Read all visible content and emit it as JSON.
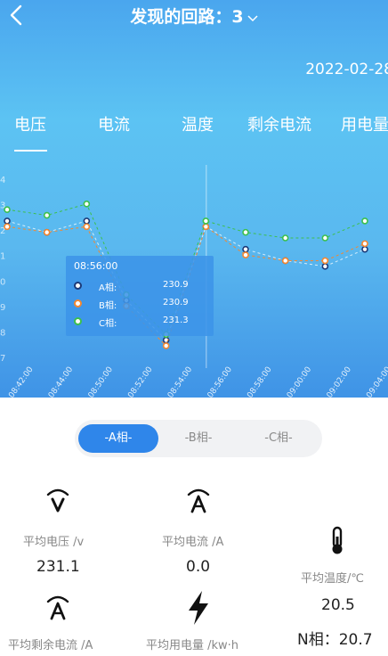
{
  "header": {
    "title": "发现的回路：3",
    "date": "2022-02-28"
  },
  "tabs": [
    {
      "label": "电压"
    },
    {
      "label": "电流"
    },
    {
      "label": "温度"
    },
    {
      "label": "剩余电流"
    },
    {
      "label": "用电量"
    }
  ],
  "chart_data": {
    "type": "line",
    "x": [
      "08:42:00",
      "08:44:00",
      "08:50:00",
      "08:52:00",
      "08:54:00",
      "08:56:00",
      "08:58:00",
      "09:00:00",
      "09:02:00",
      "09:04:00"
    ],
    "series": [
      {
        "name": "A相",
        "color": "#ffffff",
        "values": [
          231.0,
          230.8,
          231.0,
          229.6,
          228.9,
          230.9,
          230.5,
          230.3,
          230.2,
          230.5
        ]
      },
      {
        "name": "B相",
        "color": "#f5872f",
        "values": [
          230.9,
          230.8,
          230.9,
          229.5,
          228.8,
          230.9,
          230.4,
          230.3,
          230.3,
          230.6
        ]
      },
      {
        "name": "C相",
        "color": "#3cc04d",
        "values": [
          231.2,
          231.1,
          231.3,
          229.7,
          229.0,
          231.0,
          230.8,
          230.7,
          230.7,
          231.0
        ]
      }
    ],
    "ylim": [
      228.5,
      231.8
    ],
    "yticks": [
      "4",
      "3",
      "2",
      "1",
      "0",
      "9",
      "8",
      "7"
    ]
  },
  "tooltip": {
    "time": "08:56:00",
    "rows": [
      {
        "name": "A相:",
        "value": "230.9",
        "color": "#ffffff"
      },
      {
        "name": "B相:",
        "value": "230.9",
        "color": "#f5872f"
      },
      {
        "name": "C相:",
        "value": "231.3",
        "color": "#3cc04d"
      }
    ]
  },
  "phase_selector": {
    "items": [
      "-A相-",
      "-B相-",
      "-C相-"
    ],
    "active_index": 0
  },
  "stats": {
    "avg_voltage": {
      "label": "平均电压 /v",
      "value": "231.1",
      "icon": "voltage-v-icon"
    },
    "avg_current": {
      "label": "平均电流 /A",
      "value": "0.0",
      "icon": "current-a-icon"
    },
    "avg_temp": {
      "label": "平均温度/℃",
      "value": "20.5",
      "icon": "thermometer-icon"
    },
    "n_phase": {
      "label": "N相：",
      "value": "20.7"
    },
    "avg_residual": {
      "label": "平均剩余电流 /A",
      "icon": "residual-current-icon"
    },
    "avg_energy": {
      "label": "平均用电量 /kw·h",
      "icon": "lightning-icon"
    }
  },
  "colors": {
    "accent": "#2f86ea",
    "header": "#4aa6ee"
  }
}
